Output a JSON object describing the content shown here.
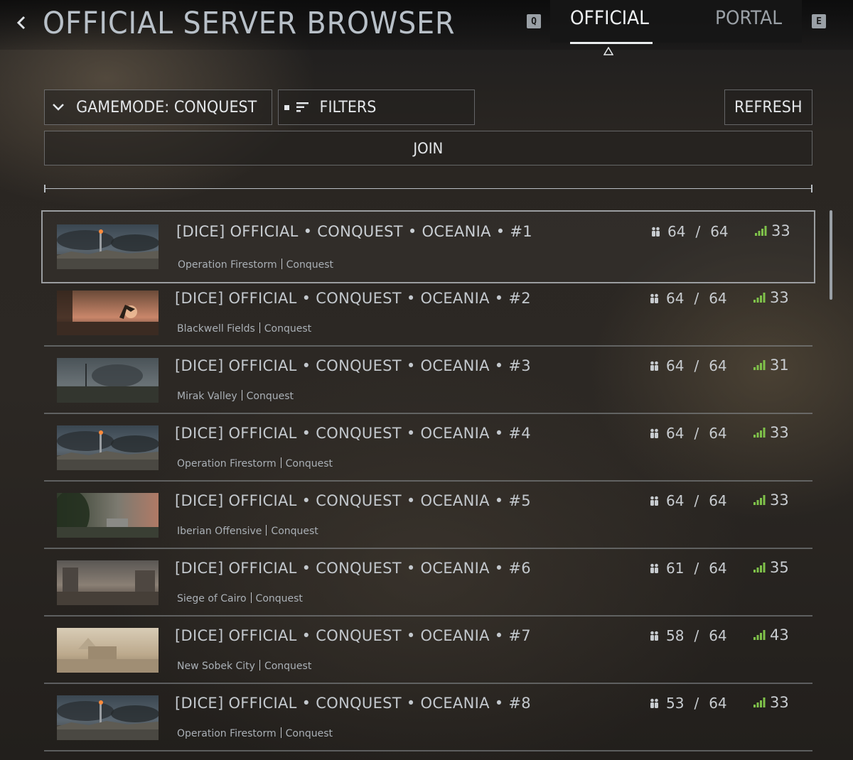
{
  "header": {
    "title": "OFFICIAL SERVER BROWSER",
    "prev_tab_key": "Q",
    "next_tab_key": "E",
    "tabs": [
      {
        "label": "OFFICIAL",
        "active": true
      },
      {
        "label": "PORTAL",
        "active": false
      }
    ]
  },
  "toolbar": {
    "gamemode_label": "GAMEMODE: CONQUEST",
    "filters_label": "FILTERS",
    "refresh_label": "REFRESH",
    "join_label": "JOIN"
  },
  "servers": [
    {
      "name": "[DICE] OFFICIAL • CONQUEST • OCEANIA • #1",
      "map": "Operation Firestorm",
      "mode": "Conquest",
      "players": "64",
      "max": "64",
      "ping": "33",
      "selected": true,
      "thumb": "firestorm"
    },
    {
      "name": "[DICE] OFFICIAL • CONQUEST • OCEANIA • #2",
      "map": "Blackwell Fields",
      "mode": "Conquest",
      "players": "64",
      "max": "64",
      "ping": "33",
      "selected": false,
      "thumb": "blackwell"
    },
    {
      "name": "[DICE] OFFICIAL • CONQUEST • OCEANIA • #3",
      "map": "Mirak Valley",
      "mode": "Conquest",
      "players": "64",
      "max": "64",
      "ping": "31",
      "selected": false,
      "thumb": "mirak"
    },
    {
      "name": "[DICE] OFFICIAL • CONQUEST • OCEANIA • #4",
      "map": "Operation Firestorm",
      "mode": "Conquest",
      "players": "64",
      "max": "64",
      "ping": "33",
      "selected": false,
      "thumb": "firestorm"
    },
    {
      "name": "[DICE] OFFICIAL • CONQUEST • OCEANIA • #5",
      "map": "Iberian Offensive",
      "mode": "Conquest",
      "players": "64",
      "max": "64",
      "ping": "33",
      "selected": false,
      "thumb": "iberian"
    },
    {
      "name": "[DICE] OFFICIAL • CONQUEST • OCEANIA • #6",
      "map": "Siege of Cairo",
      "mode": "Conquest",
      "players": "61",
      "max": "64",
      "ping": "35",
      "selected": false,
      "thumb": "cairo"
    },
    {
      "name": "[DICE] OFFICIAL • CONQUEST • OCEANIA • #7",
      "map": "New Sobek City",
      "mode": "Conquest",
      "players": "58",
      "max": "64",
      "ping": "43",
      "selected": false,
      "thumb": "sobek"
    },
    {
      "name": "[DICE] OFFICIAL • CONQUEST • OCEANIA • #8",
      "map": "Operation Firestorm",
      "mode": "Conquest",
      "players": "53",
      "max": "64",
      "ping": "33",
      "selected": false,
      "thumb": "firestorm"
    }
  ],
  "colors": {
    "signal_good": "#7fc24a",
    "text_primary": "#c3c8cd",
    "tab_active": "#eef1f3"
  },
  "icons": {
    "back": "chevron-left-icon",
    "gamemode": "chevron-down-icon",
    "filters": "filter-icon",
    "players": "players-icon",
    "ping": "signal-bars-icon"
  }
}
